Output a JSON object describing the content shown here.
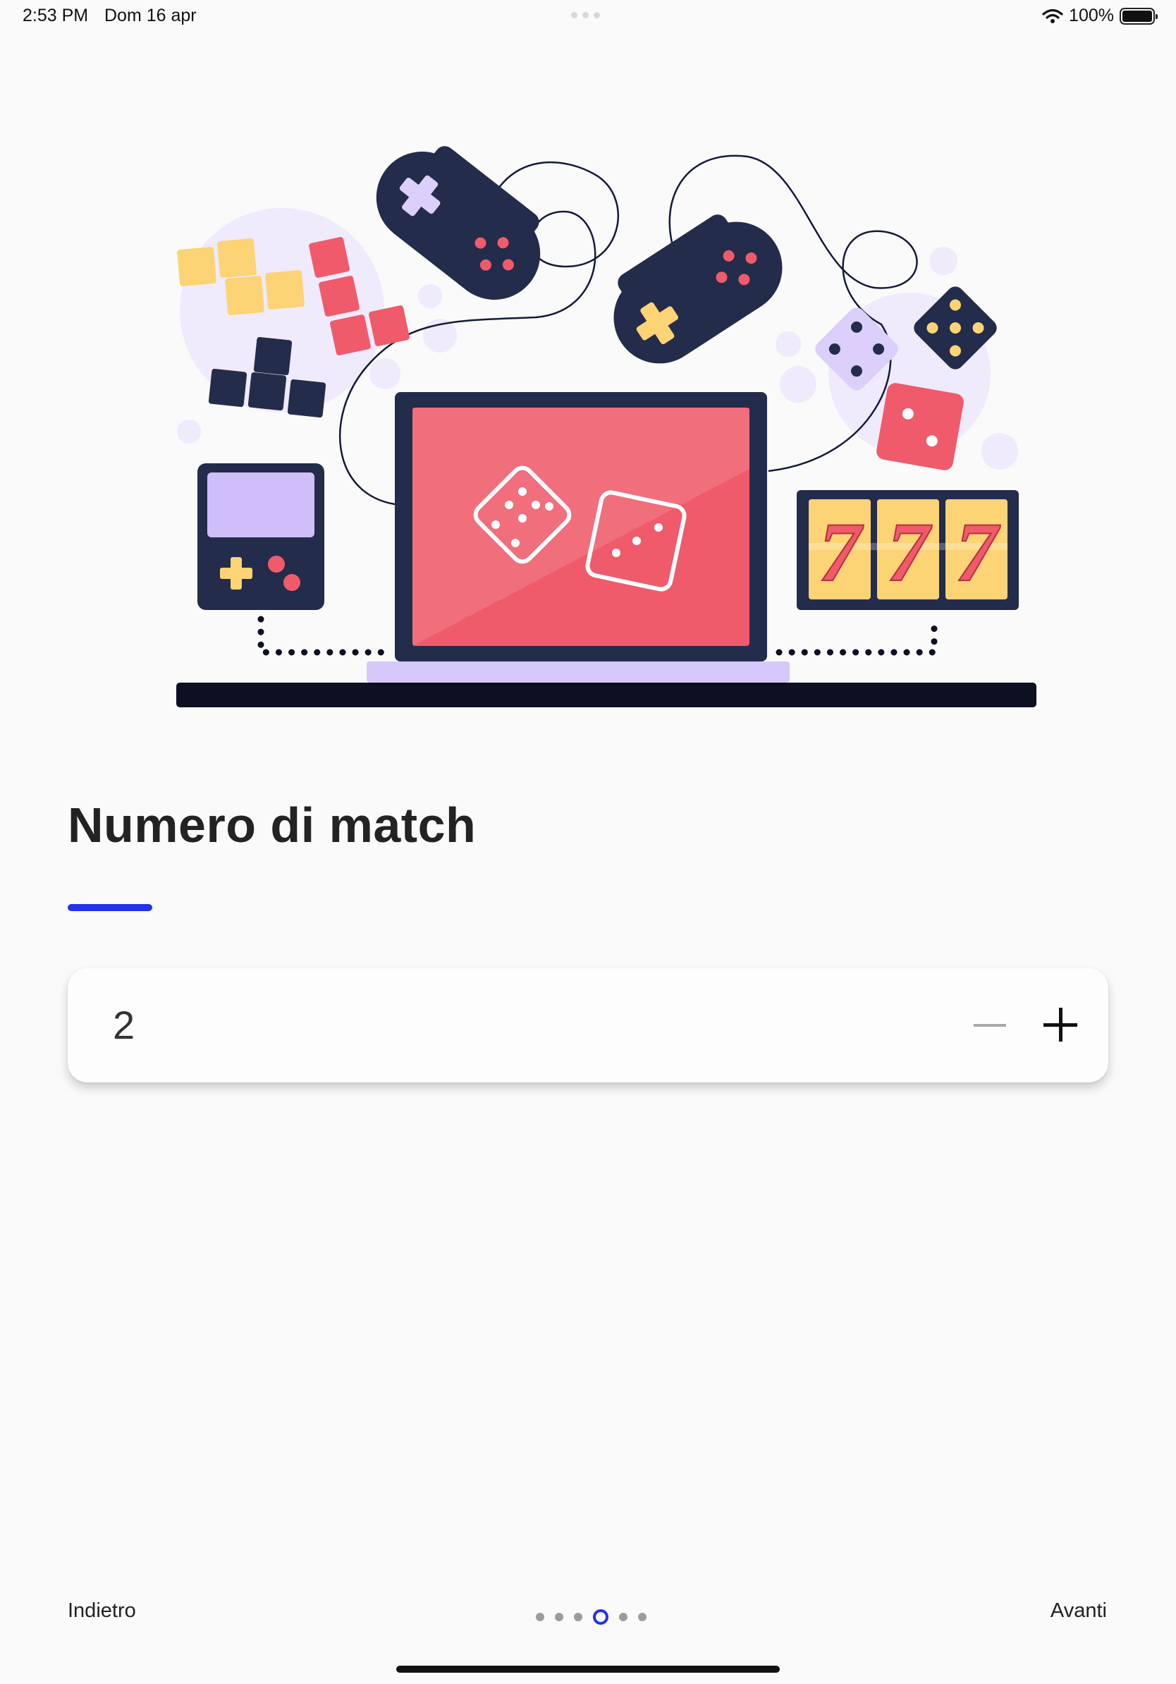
{
  "status_bar": {
    "time": "2:53 PM",
    "date": "Dom 16 apr",
    "battery": "100%",
    "wifi_icon": "wifi-icon",
    "battery_icon": "battery-icon"
  },
  "illustration": {
    "slot_symbols": [
      "7",
      "7",
      "7"
    ]
  },
  "page": {
    "title": "Numero di match",
    "accent_color": "#2233ee"
  },
  "stepper": {
    "value": "2",
    "minus_icon": "minus-icon",
    "plus_icon": "plus-icon"
  },
  "navigation": {
    "back_label": "Indietro",
    "next_label": "Avanti",
    "page_count": 6,
    "current_page": 4
  }
}
